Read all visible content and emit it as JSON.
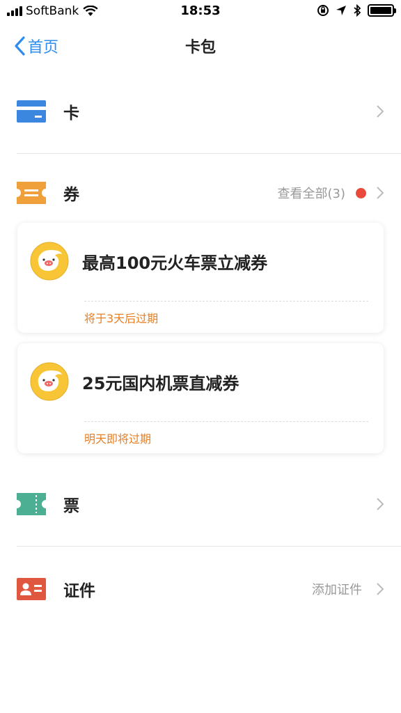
{
  "status_bar": {
    "carrier": "SoftBank",
    "time": "18:53"
  },
  "nav": {
    "back_label": "首页",
    "title": "卡包"
  },
  "sections": {
    "cards": {
      "label": "卡"
    },
    "coupons": {
      "label": "券",
      "view_all": "查看全部(3)"
    },
    "tickets": {
      "label": "票"
    },
    "ids": {
      "label": "证件",
      "add": "添加证件"
    }
  },
  "coupons": [
    {
      "title": "最高100元火车票立减券",
      "expire": "将于3天后过期"
    },
    {
      "title": "25元国内机票直减券",
      "expire": "明天即将过期"
    }
  ],
  "colors": {
    "accent": "#2d8cf0",
    "card_icon": "#3b86df",
    "coupon_icon": "#f0a03a",
    "ticket_icon": "#4cae93",
    "id_icon": "#e0573f",
    "expire_text": "#e67e22",
    "badge_dot": "#e94a3c",
    "logo_yellow": "#f7c535"
  }
}
